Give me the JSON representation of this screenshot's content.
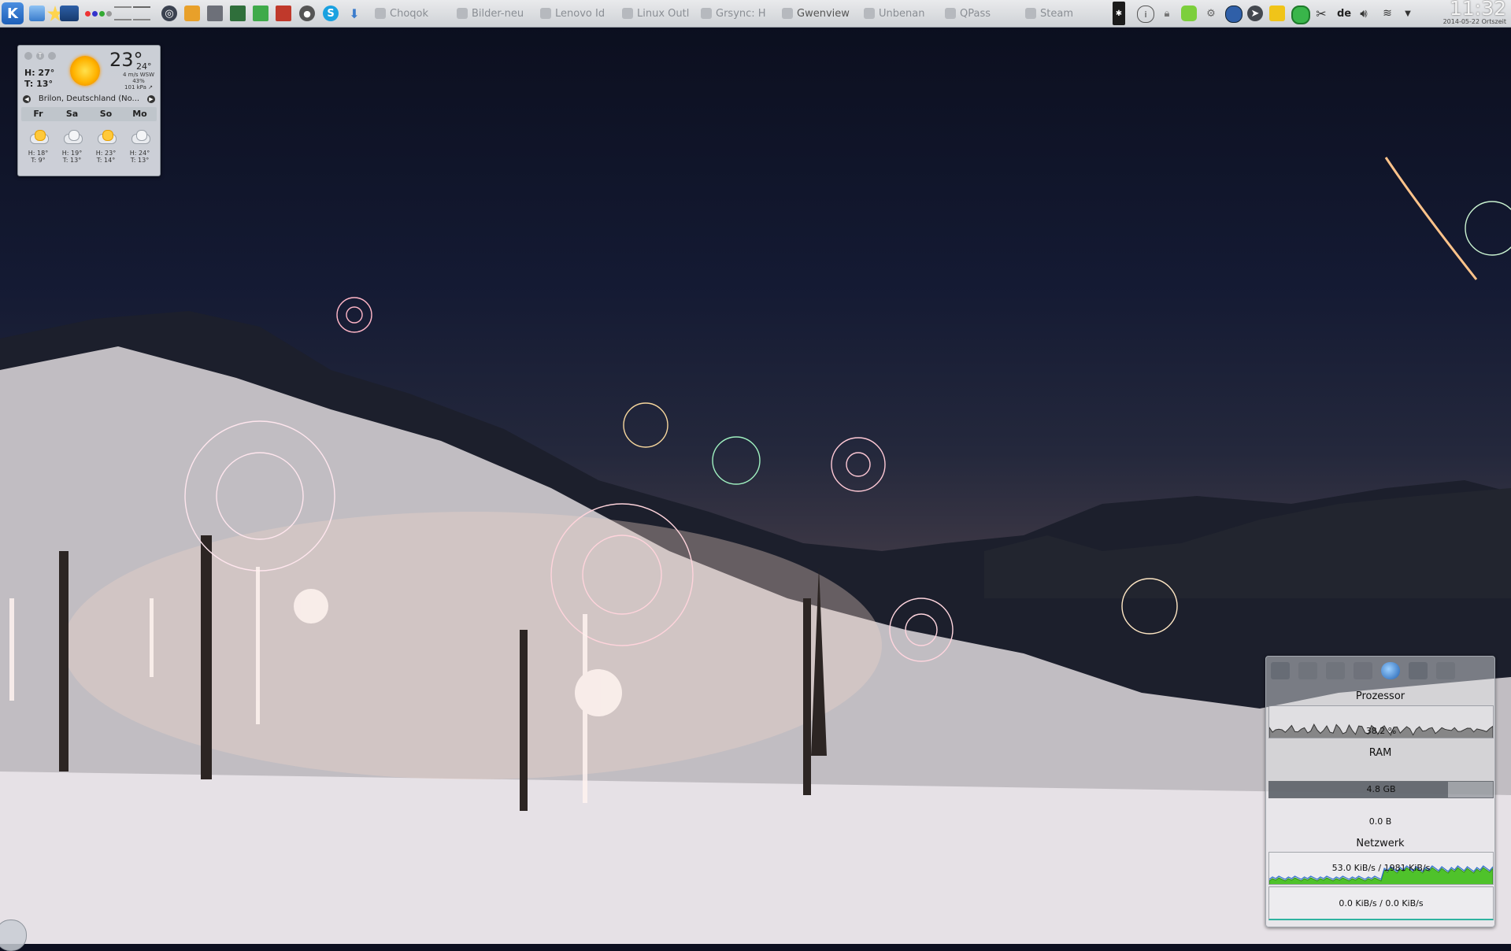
{
  "panel": {
    "kicker_letter": "K",
    "launchers": [
      "dolphin-icon",
      "kstars-icon",
      "monitor-icon",
      "color-dots-icon"
    ],
    "tasks": [
      {
        "label": "Choqok",
        "icon": "choqok-icon"
      },
      {
        "label": "Bilder-neu",
        "icon": "folder-icon"
      },
      {
        "label": "Lenovo Id",
        "icon": "browser-icon"
      },
      {
        "label": "Linux Outl",
        "icon": "browser-icon"
      },
      {
        "label": "Grsync: H",
        "icon": "sync-icon"
      },
      {
        "label": "Gwenview",
        "icon": "gwenview-icon"
      },
      {
        "label": "Unbenan",
        "icon": "document-icon"
      },
      {
        "label": "QPass",
        "icon": "lock-icon"
      },
      {
        "label": "Steam",
        "icon": "steam-icon"
      }
    ],
    "tray": {
      "keyboard_layout": "de"
    },
    "clock": {
      "time": "11:32",
      "date": "2014-05-22 Ortszeit"
    }
  },
  "weather": {
    "high": "H: 27°",
    "low": "T: 13°",
    "temp": "23°",
    "temp_secondary": "24°",
    "wind": "4 m/s WSW",
    "humidity": "43%",
    "pressure": "101 kPa ↗",
    "location": "Brilon, Deutschland (No...",
    "days": [
      "Fr",
      "Sa",
      "So",
      "Mo"
    ],
    "forecast": [
      {
        "icon": "partly-sunny-icon",
        "high": "H: 18°",
        "low": "T: 9°"
      },
      {
        "icon": "cloudy-icon",
        "high": "H: 19°",
        "low": "T: 13°"
      },
      {
        "icon": "partly-sunny-icon",
        "high": "H: 23°",
        "low": "T: 14°"
      },
      {
        "icon": "cloudy-icon",
        "high": "H: 24°",
        "low": "T: 13°"
      }
    ]
  },
  "sysmon": {
    "cpu_title": "Prozessor",
    "cpu_value": "38.2 %",
    "ram_title": "RAM",
    "ram_value": "4.8 GB",
    "ram_fraction": 0.8,
    "swap_value": "0.0 B",
    "net_title": "Netzwerk",
    "net_value1": "53.0 KiB/s / 1981 KiB/s",
    "net_value2": "0.0 KiB/s / 0.0 KiB/s"
  },
  "colors": {
    "panel_bg": "#d9dbde",
    "accent": "#1e5fb8",
    "net_green": "#4fc22b"
  }
}
